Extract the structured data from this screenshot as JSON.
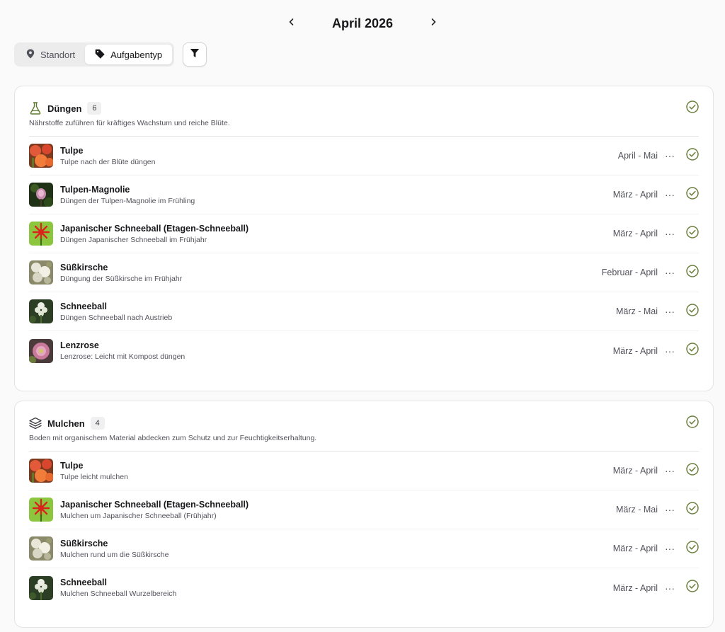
{
  "header": {
    "month_title": "April 2026",
    "prev_icon": "chevron-left-icon",
    "next_icon": "chevron-right-icon"
  },
  "filters": {
    "segments": [
      {
        "label": "Standort",
        "icon": "map-pin-icon",
        "active": false
      },
      {
        "label": "Aufgabentyp",
        "icon": "tag-icon",
        "active": true
      }
    ],
    "filter_icon": "funnel-icon"
  },
  "colors": {
    "check": "#6b7f3a",
    "accent_green": "#5f7a2e"
  },
  "groups": [
    {
      "title": "Düngen",
      "count": "6",
      "icon": "flask-icon",
      "description": "Nährstoffe zuführen für kräftiges Wachstum und reiche Blüte.",
      "tasks": [
        {
          "plant": "Tulpe",
          "task": "Tulpe nach der Blüte düngen",
          "range": "April - Mai",
          "thumb": "tulip"
        },
        {
          "plant": "Tulpen-Magnolie",
          "task": "Düngen der Tulpen-Magnolie im Frühling",
          "range": "März - April",
          "thumb": "magnolia"
        },
        {
          "plant": "Japanischer Schneeball (Etagen-Schneeball)",
          "task": "Düngen Japanischer Schneeball im Frühjahr",
          "range": "März - April",
          "thumb": "viburnum"
        },
        {
          "plant": "Süßkirsche",
          "task": "Düngung der Süßkirsche im Frühjahr",
          "range": "Februar - April",
          "thumb": "cherry"
        },
        {
          "plant": "Schneeball",
          "task": "Düngen Schneeball nach Austrieb",
          "range": "März - Mai",
          "thumb": "snowball"
        },
        {
          "plant": "Lenzrose",
          "task": "Lenzrose: Leicht mit Kompost düngen",
          "range": "März - April",
          "thumb": "hellebore"
        }
      ]
    },
    {
      "title": "Mulchen",
      "count": "4",
      "icon": "layers-icon",
      "description": "Boden mit organischem Material abdecken zum Schutz und zur Feuchtigkeitserhaltung.",
      "tasks": [
        {
          "plant": "Tulpe",
          "task": "Tulpe leicht mulchen",
          "range": "März - April",
          "thumb": "tulip"
        },
        {
          "plant": "Japanischer Schneeball (Etagen-Schneeball)",
          "task": "Mulchen um Japanischer Schneeball (Frühjahr)",
          "range": "März - Mai",
          "thumb": "viburnum"
        },
        {
          "plant": "Süßkirsche",
          "task": "Mulchen rund um die Süßkirsche",
          "range": "März - April",
          "thumb": "cherry"
        },
        {
          "plant": "Schneeball",
          "task": "Mulchen Schneeball Wurzelbereich",
          "range": "März - April",
          "thumb": "snowball"
        }
      ]
    }
  ]
}
